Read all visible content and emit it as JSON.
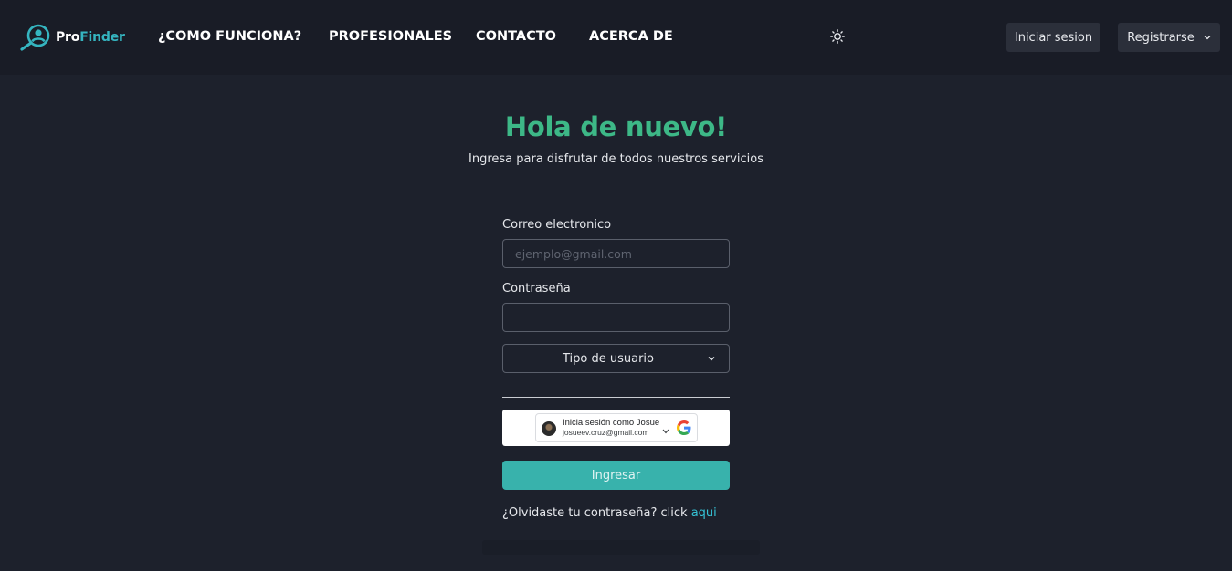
{
  "nav": {
    "logo_pro": "Pro",
    "logo_finder": "Finder",
    "links": [
      "¿COMO FUNCIONA?",
      "PROFESIONALES",
      "CONTACTO",
      "ACERCA DE"
    ],
    "login_label": "Iniciar sesion",
    "register_label": "Registrarse"
  },
  "hero": {
    "title": "Hola de nuevo!",
    "subtitle": "Ingresa para disfrutar de todos nuestros servicios"
  },
  "form": {
    "email_label": "Correo electronico",
    "email_placeholder": "ejemplo@gmail.com",
    "password_label": "Contraseña",
    "user_type_selected": "Tipo de usuario",
    "google_signin_name": "Inicia sesión como Josue",
    "google_signin_email": "josueev.cruz@gmail.com",
    "submit_label": "Ingresar",
    "forgot_text": "¿Olvidaste tu contraseña? click",
    "forgot_link": "aqui"
  },
  "colors": {
    "background": "#1d212c",
    "navbar": "#191c26",
    "title_green": "#3db887",
    "accent_teal": "#38b2ac",
    "link_cyan": "#35c3d6"
  },
  "icons": {
    "logo": "magnifier-person-icon",
    "theme_toggle": "sun-icon",
    "register_caret": "chevron-down-icon",
    "select_caret": "chevron-down-icon",
    "google": "google-g-icon"
  }
}
